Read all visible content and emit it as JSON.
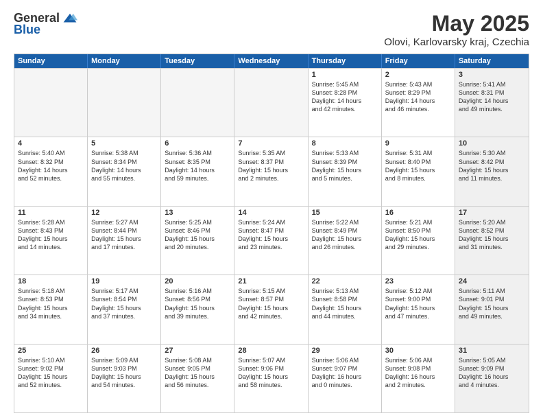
{
  "header": {
    "logo_general": "General",
    "logo_blue": "Blue",
    "title": "May 2025",
    "subtitle": "Olovi, Karlovarsky kraj, Czechia"
  },
  "calendar": {
    "days": [
      "Sunday",
      "Monday",
      "Tuesday",
      "Wednesday",
      "Thursday",
      "Friday",
      "Saturday"
    ],
    "rows": [
      [
        {
          "num": "",
          "text": "",
          "empty": true
        },
        {
          "num": "",
          "text": "",
          "empty": true
        },
        {
          "num": "",
          "text": "",
          "empty": true
        },
        {
          "num": "",
          "text": "",
          "empty": true
        },
        {
          "num": "1",
          "text": "Sunrise: 5:45 AM\nSunset: 8:28 PM\nDaylight: 14 hours\nand 42 minutes.",
          "empty": false
        },
        {
          "num": "2",
          "text": "Sunrise: 5:43 AM\nSunset: 8:29 PM\nDaylight: 14 hours\nand 46 minutes.",
          "empty": false
        },
        {
          "num": "3",
          "text": "Sunrise: 5:41 AM\nSunset: 8:31 PM\nDaylight: 14 hours\nand 49 minutes.",
          "empty": false,
          "shaded": true
        }
      ],
      [
        {
          "num": "4",
          "text": "Sunrise: 5:40 AM\nSunset: 8:32 PM\nDaylight: 14 hours\nand 52 minutes.",
          "empty": false
        },
        {
          "num": "5",
          "text": "Sunrise: 5:38 AM\nSunset: 8:34 PM\nDaylight: 14 hours\nand 55 minutes.",
          "empty": false
        },
        {
          "num": "6",
          "text": "Sunrise: 5:36 AM\nSunset: 8:35 PM\nDaylight: 14 hours\nand 59 minutes.",
          "empty": false
        },
        {
          "num": "7",
          "text": "Sunrise: 5:35 AM\nSunset: 8:37 PM\nDaylight: 15 hours\nand 2 minutes.",
          "empty": false
        },
        {
          "num": "8",
          "text": "Sunrise: 5:33 AM\nSunset: 8:39 PM\nDaylight: 15 hours\nand 5 minutes.",
          "empty": false
        },
        {
          "num": "9",
          "text": "Sunrise: 5:31 AM\nSunset: 8:40 PM\nDaylight: 15 hours\nand 8 minutes.",
          "empty": false
        },
        {
          "num": "10",
          "text": "Sunrise: 5:30 AM\nSunset: 8:42 PM\nDaylight: 15 hours\nand 11 minutes.",
          "empty": false,
          "shaded": true
        }
      ],
      [
        {
          "num": "11",
          "text": "Sunrise: 5:28 AM\nSunset: 8:43 PM\nDaylight: 15 hours\nand 14 minutes.",
          "empty": false
        },
        {
          "num": "12",
          "text": "Sunrise: 5:27 AM\nSunset: 8:44 PM\nDaylight: 15 hours\nand 17 minutes.",
          "empty": false
        },
        {
          "num": "13",
          "text": "Sunrise: 5:25 AM\nSunset: 8:46 PM\nDaylight: 15 hours\nand 20 minutes.",
          "empty": false
        },
        {
          "num": "14",
          "text": "Sunrise: 5:24 AM\nSunset: 8:47 PM\nDaylight: 15 hours\nand 23 minutes.",
          "empty": false
        },
        {
          "num": "15",
          "text": "Sunrise: 5:22 AM\nSunset: 8:49 PM\nDaylight: 15 hours\nand 26 minutes.",
          "empty": false
        },
        {
          "num": "16",
          "text": "Sunrise: 5:21 AM\nSunset: 8:50 PM\nDaylight: 15 hours\nand 29 minutes.",
          "empty": false
        },
        {
          "num": "17",
          "text": "Sunrise: 5:20 AM\nSunset: 8:52 PM\nDaylight: 15 hours\nand 31 minutes.",
          "empty": false,
          "shaded": true
        }
      ],
      [
        {
          "num": "18",
          "text": "Sunrise: 5:18 AM\nSunset: 8:53 PM\nDaylight: 15 hours\nand 34 minutes.",
          "empty": false
        },
        {
          "num": "19",
          "text": "Sunrise: 5:17 AM\nSunset: 8:54 PM\nDaylight: 15 hours\nand 37 minutes.",
          "empty": false
        },
        {
          "num": "20",
          "text": "Sunrise: 5:16 AM\nSunset: 8:56 PM\nDaylight: 15 hours\nand 39 minutes.",
          "empty": false
        },
        {
          "num": "21",
          "text": "Sunrise: 5:15 AM\nSunset: 8:57 PM\nDaylight: 15 hours\nand 42 minutes.",
          "empty": false
        },
        {
          "num": "22",
          "text": "Sunrise: 5:13 AM\nSunset: 8:58 PM\nDaylight: 15 hours\nand 44 minutes.",
          "empty": false
        },
        {
          "num": "23",
          "text": "Sunrise: 5:12 AM\nSunset: 9:00 PM\nDaylight: 15 hours\nand 47 minutes.",
          "empty": false
        },
        {
          "num": "24",
          "text": "Sunrise: 5:11 AM\nSunset: 9:01 PM\nDaylight: 15 hours\nand 49 minutes.",
          "empty": false,
          "shaded": true
        }
      ],
      [
        {
          "num": "25",
          "text": "Sunrise: 5:10 AM\nSunset: 9:02 PM\nDaylight: 15 hours\nand 52 minutes.",
          "empty": false
        },
        {
          "num": "26",
          "text": "Sunrise: 5:09 AM\nSunset: 9:03 PM\nDaylight: 15 hours\nand 54 minutes.",
          "empty": false
        },
        {
          "num": "27",
          "text": "Sunrise: 5:08 AM\nSunset: 9:05 PM\nDaylight: 15 hours\nand 56 minutes.",
          "empty": false
        },
        {
          "num": "28",
          "text": "Sunrise: 5:07 AM\nSunset: 9:06 PM\nDaylight: 15 hours\nand 58 minutes.",
          "empty": false
        },
        {
          "num": "29",
          "text": "Sunrise: 5:06 AM\nSunset: 9:07 PM\nDaylight: 16 hours\nand 0 minutes.",
          "empty": false
        },
        {
          "num": "30",
          "text": "Sunrise: 5:06 AM\nSunset: 9:08 PM\nDaylight: 16 hours\nand 2 minutes.",
          "empty": false
        },
        {
          "num": "31",
          "text": "Sunrise: 5:05 AM\nSunset: 9:09 PM\nDaylight: 16 hours\nand 4 minutes.",
          "empty": false,
          "shaded": true
        }
      ]
    ]
  }
}
